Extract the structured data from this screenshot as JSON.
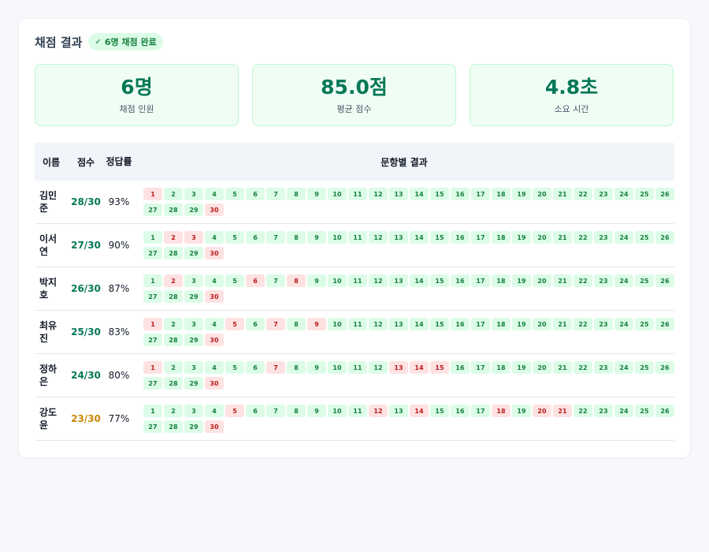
{
  "header": {
    "title": "채점 결과",
    "badge_icon": "✓",
    "badge_text": "6명 채점 완료"
  },
  "stats": [
    {
      "value": "6명",
      "label": "채점 인원"
    },
    {
      "value": "85.0점",
      "label": "평균 점수"
    },
    {
      "value": "4.8초",
      "label": "소요 시간"
    }
  ],
  "table": {
    "headers": {
      "name": "이름",
      "score": "점수",
      "rate": "정답률",
      "items": "문항별 결과"
    },
    "rows": [
      {
        "name": "김민준",
        "score": "28/30",
        "rate": "93%",
        "score_color": "#047857",
        "wrong": [
          1,
          30
        ]
      },
      {
        "name": "이서연",
        "score": "27/30",
        "rate": "90%",
        "score_color": "#047857",
        "wrong": [
          2,
          3,
          30
        ]
      },
      {
        "name": "박지호",
        "score": "26/30",
        "rate": "87%",
        "score_color": "#047857",
        "wrong": [
          2,
          6,
          8,
          30
        ]
      },
      {
        "name": "최유진",
        "score": "25/30",
        "rate": "83%",
        "score_color": "#047857",
        "wrong": [
          1,
          5,
          7,
          9,
          30
        ]
      },
      {
        "name": "정하은",
        "score": "24/30",
        "rate": "80%",
        "score_color": "#047857",
        "wrong": [
          1,
          7,
          13,
          14,
          15,
          30
        ]
      },
      {
        "name": "강도윤",
        "score": "23/30",
        "rate": "77%",
        "score_color": "#ca8a04",
        "wrong": [
          5,
          12,
          14,
          18,
          20,
          21,
          30
        ]
      }
    ]
  },
  "colors": {
    "correct_bg": "#dcfce7",
    "wrong_bg": "#fee2e2",
    "accent": "#047857"
  }
}
